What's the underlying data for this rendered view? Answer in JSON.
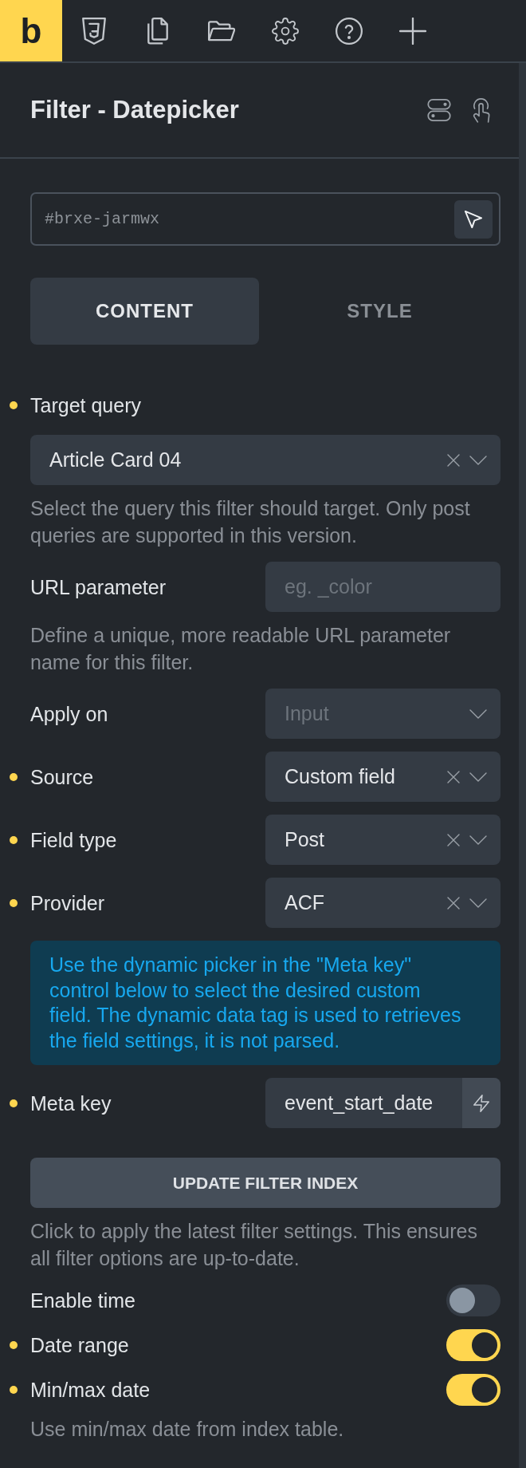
{
  "toolbar": {
    "logo": "b"
  },
  "header": {
    "title": "Filter - Datepicker"
  },
  "element_id": {
    "value": "#brxe-jarmwx"
  },
  "tabs": [
    {
      "label": "CONTENT",
      "selected": true
    },
    {
      "label": "STYLE",
      "selected": false
    }
  ],
  "controls": [
    {
      "kind": "select-block",
      "label": "Target query",
      "modified": true,
      "value": "Article Card 04",
      "description": "Select the query this filter should target. Only post queries are supported in this version."
    },
    {
      "kind": "text",
      "label": "URL parameter",
      "modified": false,
      "placeholder": "eg. _color",
      "description": "Define a unique, more readable URL parameter name for this filter."
    },
    {
      "kind": "select",
      "label": "Apply on",
      "modified": false,
      "placeholder": "Input"
    },
    {
      "kind": "select",
      "label": "Source",
      "modified": true,
      "value": "Custom field"
    },
    {
      "kind": "select",
      "label": "Field type",
      "modified": true,
      "value": "Post"
    },
    {
      "kind": "select",
      "label": "Provider",
      "modified": true,
      "value": "ACF"
    },
    {
      "kind": "info",
      "text": "Use the dynamic picker in the \"Meta key\" control below to select the desired custom field. The dynamic data tag is used to retrieves the field settings, it is not parsed."
    },
    {
      "kind": "dynamic",
      "label": "Meta key",
      "modified": true,
      "value": "event_start_date"
    },
    {
      "kind": "button",
      "label": "UPDATE FILTER INDEX",
      "description": "Click to apply the latest filter settings. This ensures all filter options are up-to-date."
    },
    {
      "kind": "toggle",
      "label": "Enable time",
      "modified": false,
      "on": false
    },
    {
      "kind": "toggle",
      "label": "Date range",
      "modified": true,
      "on": true
    },
    {
      "kind": "toggle",
      "label": "Min/max date",
      "modified": true,
      "on": true,
      "description": "Use min/max date from index table."
    }
  ]
}
